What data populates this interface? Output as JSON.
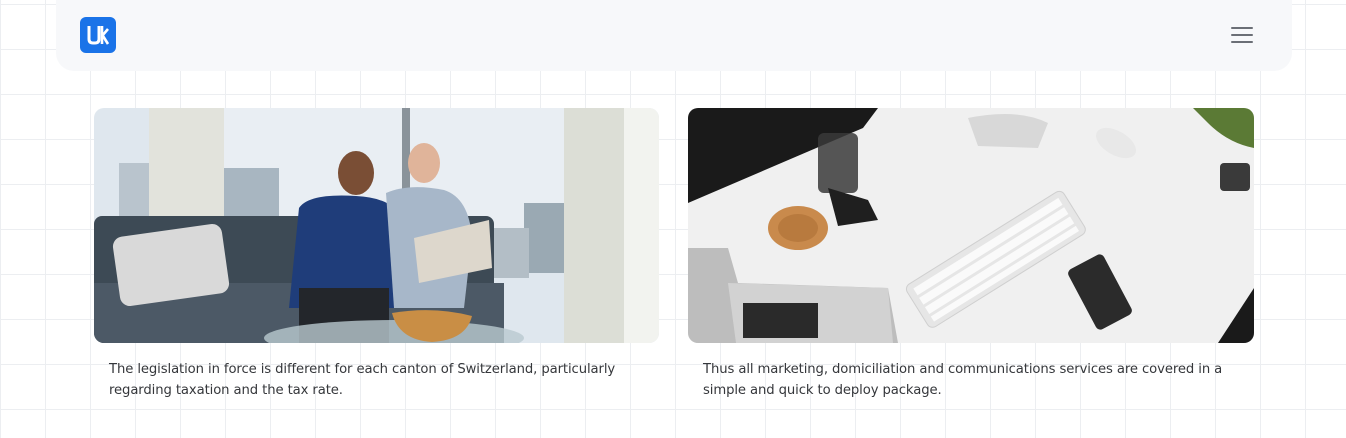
{
  "header": {
    "logo_icon": "uk-logo-icon",
    "menu_icon": "hamburger-menu-icon",
    "brand_color": "#1a73e8"
  },
  "cards": [
    {
      "image": "business-meeting-photo",
      "caption": "The legislation in force is different for each canton of Switzerland, particularly regarding taxation and the tax rate."
    },
    {
      "image": "desk-workspace-photo",
      "caption": "Thus all marketing, domiciliation and communications services are covered in a simple and quick to deploy package."
    }
  ]
}
